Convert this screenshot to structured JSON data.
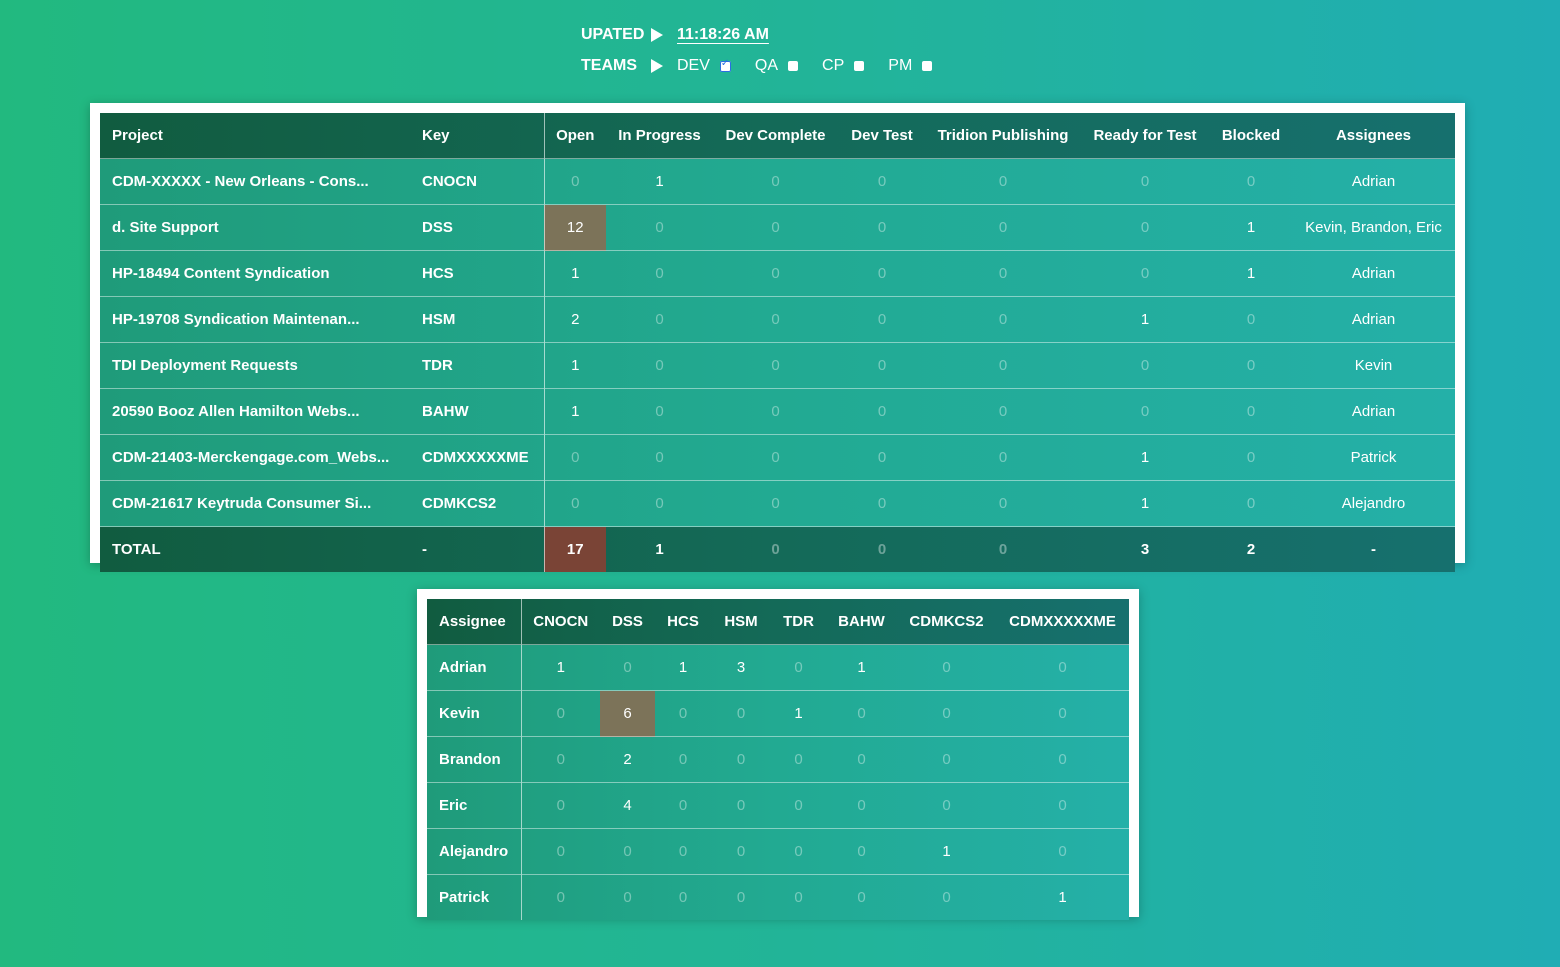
{
  "header": {
    "updated_label": "UPATED",
    "updated_time": "11:18:26 AM",
    "teams_label": "TEAMS",
    "teams": [
      {
        "name": "DEV",
        "checked": true
      },
      {
        "name": "QA",
        "checked": false
      },
      {
        "name": "CP",
        "checked": false
      },
      {
        "name": "PM",
        "checked": false
      }
    ]
  },
  "projects_table": {
    "columns": [
      "Project",
      "Key",
      "Open",
      "In Progress",
      "Dev Complete",
      "Dev Test",
      "Tridion Publishing",
      "Ready for Test",
      "Blocked",
      "Assignees"
    ],
    "rows": [
      [
        "CDM-XXXXX - New Orleans - Cons...",
        "CNOCN",
        "0",
        "1",
        "0",
        "0",
        "0",
        "0",
        "0",
        "Adrian"
      ],
      [
        "d. Site Support",
        "DSS",
        "12",
        "0",
        "0",
        "0",
        "0",
        "0",
        "1",
        "Kevin, Brandon, Eric"
      ],
      [
        "HP-18494 Content Syndication",
        "HCS",
        "1",
        "0",
        "0",
        "0",
        "0",
        "0",
        "1",
        "Adrian"
      ],
      [
        "HP-19708 Syndication Maintenan...",
        "HSM",
        "2",
        "0",
        "0",
        "0",
        "0",
        "1",
        "0",
        "Adrian"
      ],
      [
        "TDI Deployment Requests",
        "TDR",
        "1",
        "0",
        "0",
        "0",
        "0",
        "0",
        "0",
        "Kevin"
      ],
      [
        "20590 Booz Allen Hamilton Webs...",
        "BAHW",
        "1",
        "0",
        "0",
        "0",
        "0",
        "0",
        "0",
        "Adrian"
      ],
      [
        "CDM-21403-Merckengage.com_Webs...",
        "CDMXXXXXME",
        "0",
        "0",
        "0",
        "0",
        "0",
        "1",
        "0",
        "Patrick"
      ],
      [
        "CDM-21617 Keytruda Consumer Si...",
        "CDMKCS2",
        "0",
        "0",
        "0",
        "0",
        "0",
        "1",
        "0",
        "Alejandro"
      ]
    ],
    "total": [
      "TOTAL",
      "-",
      "17",
      "1",
      "0",
      "0",
      "0",
      "3",
      "2",
      "-"
    ]
  },
  "assignee_table": {
    "columns": [
      "Assignee",
      "CNOCN",
      "DSS",
      "HCS",
      "HSM",
      "TDR",
      "BAHW",
      "CDMKCS2",
      "CDMXXXXXME"
    ],
    "rows": [
      [
        "Adrian",
        "1",
        "0",
        "1",
        "3",
        "0",
        "1",
        "0",
        "0"
      ],
      [
        "Kevin",
        "0",
        "6",
        "0",
        "0",
        "1",
        "0",
        "0",
        "0"
      ],
      [
        "Brandon",
        "0",
        "2",
        "0",
        "0",
        "0",
        "0",
        "0",
        "0"
      ],
      [
        "Eric",
        "0",
        "4",
        "0",
        "0",
        "0",
        "0",
        "0",
        "0"
      ],
      [
        "Alejandro",
        "0",
        "0",
        "0",
        "0",
        "0",
        "0",
        "1",
        "0"
      ],
      [
        "Patrick",
        "0",
        "0",
        "0",
        "0",
        "0",
        "0",
        "0",
        "1"
      ]
    ]
  },
  "colors": {
    "highlight": "#7c7359",
    "total_highlight": "#7a4436",
    "checkbox_checked": "#2b6fe0"
  }
}
